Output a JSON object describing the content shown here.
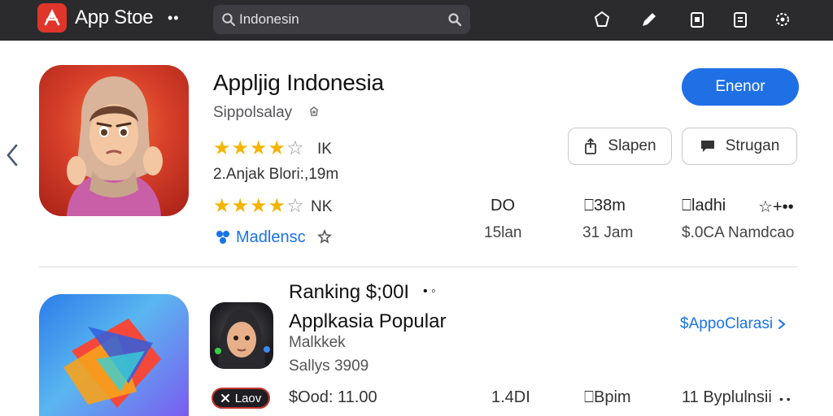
{
  "topbar": {
    "app_title": "App Stoe",
    "more": "••",
    "search": {
      "value": "Indonesin",
      "placeholder": ""
    },
    "icons": [
      "profile-icon",
      "pen-icon",
      "clipboard-icon",
      "document-icon",
      "settings-icon"
    ]
  },
  "featured": {
    "title": "Appljig Indonesia",
    "subtitle": "Sippolsalay",
    "rating1": {
      "stars": 4,
      "of": 5,
      "label": "IK"
    },
    "meta": "2.Anjak Blori:,19m",
    "rating2": {
      "stars": 4.5,
      "of": 5,
      "label": "NK"
    },
    "developer": "Madlensc",
    "primary_button": "Enenor",
    "share_button": "Slapen",
    "message_button": "Strugan",
    "stats": [
      {
        "top": "DO",
        "bottom": "15lan"
      },
      {
        "top": "⎕38m",
        "bottom": "31 Jam"
      },
      {
        "top": "⎕ladhi",
        "bottom": "$.0CA Namdcao",
        "extra": "☆+••"
      }
    ]
  },
  "ranking": {
    "heading": "Ranking $;00I",
    "heading_suffix": "• ◦",
    "app": {
      "title": "Applkasia Popular",
      "subtitle": "Malkkek",
      "meta": "Sallys 3909"
    },
    "see_all": "$AppoClarasi",
    "tag": "Laov",
    "row": [
      "$Ood: 11.00",
      "1.4DI",
      "⎕Bpim",
      "11 Byplulnsii"
    ],
    "row_dots": "• •"
  },
  "colors": {
    "accent": "#1f6fe5",
    "topbar": "#2b2b2e",
    "star": "#f5b400",
    "logo": "#e0352b"
  }
}
